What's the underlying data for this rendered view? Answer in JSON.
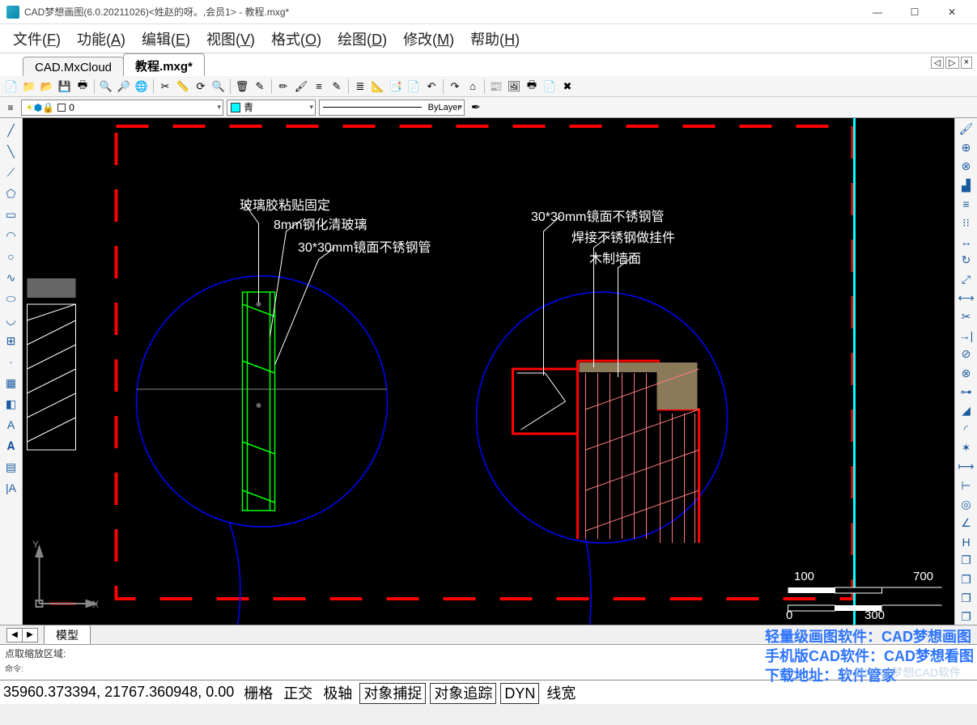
{
  "titlebar": {
    "app_icon": "cad-icon",
    "title": "CAD梦想画图(6.0.20211026)<姓赵的呀。,会员1> - 教程.mxg*",
    "min": "—",
    "max": "☐",
    "close": "✕"
  },
  "menubar": {
    "items": [
      {
        "label": "文件",
        "accel": "F"
      },
      {
        "label": "功能",
        "accel": "A"
      },
      {
        "label": "编辑",
        "accel": "E"
      },
      {
        "label": "视图",
        "accel": "V"
      },
      {
        "label": "格式",
        "accel": "O"
      },
      {
        "label": "绘图",
        "accel": "D"
      },
      {
        "label": "修改",
        "accel": "M"
      },
      {
        "label": "帮助",
        "accel": "H"
      }
    ]
  },
  "tabs": {
    "items": [
      {
        "label": "CAD.MxCloud",
        "active": false
      },
      {
        "label": "教程.mxg*",
        "active": true
      }
    ],
    "nav_left": "◁",
    "nav_right": "▷",
    "nav_close": "×"
  },
  "toolbar1_icons": [
    "📄",
    "📁",
    "📂",
    "💾",
    "🖶",
    "🔍",
    "🔎",
    "🌐",
    "✂",
    "📏",
    "⟳",
    "🔍",
    "🗑",
    "✎",
    "✏",
    "🖌",
    "≡",
    "✎",
    "≣",
    "📐",
    "📑",
    "📄",
    "↶",
    "↷",
    "⌂",
    "📰",
    "🖼",
    "🖶",
    "📄",
    "✖"
  ],
  "toolbar2": {
    "layer_combo": "0",
    "color_label": "青",
    "linetype": "ByLayer"
  },
  "left_tools": [
    "line",
    "xline",
    "pline",
    "polygon",
    "rect",
    "arc",
    "circle",
    "spline",
    "ellipse",
    "earc",
    "ins",
    "point",
    "hatch",
    "region",
    "text",
    "A",
    "table",
    "mtext"
  ],
  "right_tools": [
    "brush",
    "t1",
    "t2",
    "mirror",
    "offset",
    "array",
    "move",
    "rotate",
    "scale",
    "stretch",
    "trim",
    "extend",
    "break",
    "brk2",
    "join",
    "chamfer",
    "fillet",
    "explode",
    "dim",
    "dim2",
    "dim3",
    "ang",
    "dimH",
    "copy1",
    "copy2",
    "copy3",
    "copy4"
  ],
  "canvas": {
    "annotations": {
      "a1": "玻璃胶粘贴固定",
      "a2": "8mm钢化清玻璃",
      "a3": "30*30mm镜面不锈钢管",
      "a4": "30*30mm镜面不锈钢管",
      "a5": "焊接不锈钢做挂件",
      "a6": "木制墙面"
    },
    "scale": {
      "l1": "100",
      "l2": "700",
      "l3": "0",
      "l4": "300"
    },
    "ucs": {
      "x": "X",
      "y": "Y"
    }
  },
  "model_tabs": {
    "label": "模型"
  },
  "cmdline": {
    "line1": "点取缩放区域:",
    "line2": "命令:",
    "promo1": "轻量级画图软件：CAD梦想画图",
    "promo2": "手机版CAD软件：CAD梦想看图",
    "promo3": "下载地址：软件管家",
    "watermark": "CSDN @梦想CAD软件"
  },
  "statusbar": {
    "coords": "35960.373394, 21767.360948, 0.00",
    "toggles": [
      {
        "label": "栅格",
        "boxed": false
      },
      {
        "label": "正交",
        "boxed": false
      },
      {
        "label": "极轴",
        "boxed": false
      },
      {
        "label": "对象捕捉",
        "boxed": true
      },
      {
        "label": "对象追踪",
        "boxed": true
      },
      {
        "label": "DYN",
        "boxed": true
      },
      {
        "label": "线宽",
        "boxed": false
      }
    ]
  }
}
